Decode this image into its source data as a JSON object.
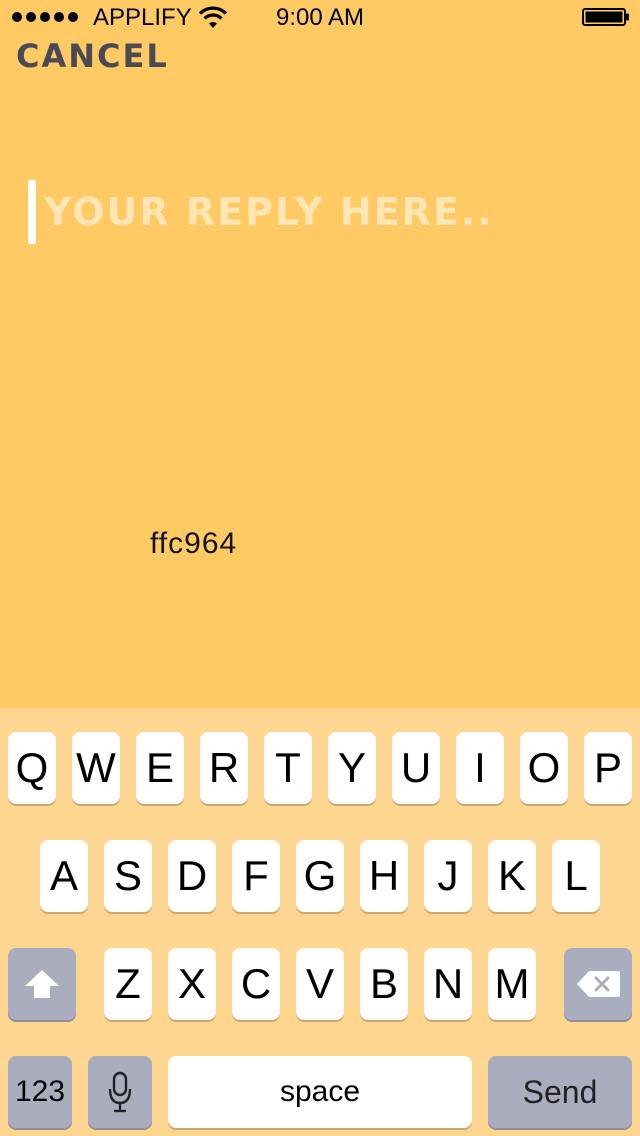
{
  "status_bar": {
    "carrier": "APPLIFY",
    "time": "9:00 AM",
    "signal_icon": "signal-dots-icon",
    "wifi_icon": "wifi-icon",
    "battery_icon": "battery-icon",
    "battery_level": 1.0
  },
  "header": {
    "cancel_label": "CANCEL"
  },
  "reply": {
    "value": "",
    "placeholder": "YOUR REPLY HERE.."
  },
  "color_label": "ffc964",
  "colors": {
    "background": "#ffc964",
    "keyboard_background": "#fed68f",
    "cancel_text": "#4a4a55",
    "caret": "#ffffff",
    "dark_key": "#a9adbe"
  },
  "keyboard": {
    "row1": [
      "Q",
      "W",
      "E",
      "R",
      "T",
      "Y",
      "U",
      "I",
      "O",
      "P"
    ],
    "row2": [
      "A",
      "S",
      "D",
      "F",
      "G",
      "H",
      "J",
      "K",
      "L"
    ],
    "row3": [
      "Z",
      "X",
      "C",
      "V",
      "B",
      "N",
      "M"
    ],
    "shift_icon": "shift-arrow-icon",
    "delete_icon": "backspace-icon",
    "numbers_label": "123",
    "mic_icon": "microphone-icon",
    "space_label": "space",
    "send_label": "Send"
  }
}
